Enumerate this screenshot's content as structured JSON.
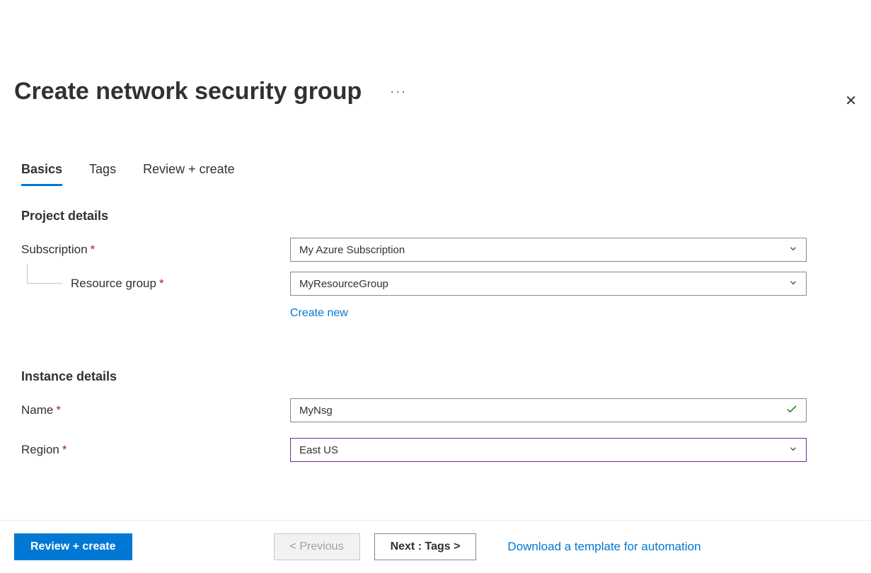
{
  "header": {
    "title": "Create network security group"
  },
  "tabs": {
    "basics": "Basics",
    "tags": "Tags",
    "review": "Review + create"
  },
  "sections": {
    "project": "Project details",
    "instance": "Instance details"
  },
  "fields": {
    "subscription_label": "Subscription",
    "subscription_value": "My Azure Subscription",
    "resource_group_label": "Resource group",
    "resource_group_value": "MyResourceGroup",
    "create_new": "Create new",
    "name_label": "Name",
    "name_value": "MyNsg",
    "region_label": "Region",
    "region_value": "East US"
  },
  "footer": {
    "review_create": "Review + create",
    "previous": "< Previous",
    "next": "Next : Tags >",
    "download_template": "Download a template for automation"
  }
}
